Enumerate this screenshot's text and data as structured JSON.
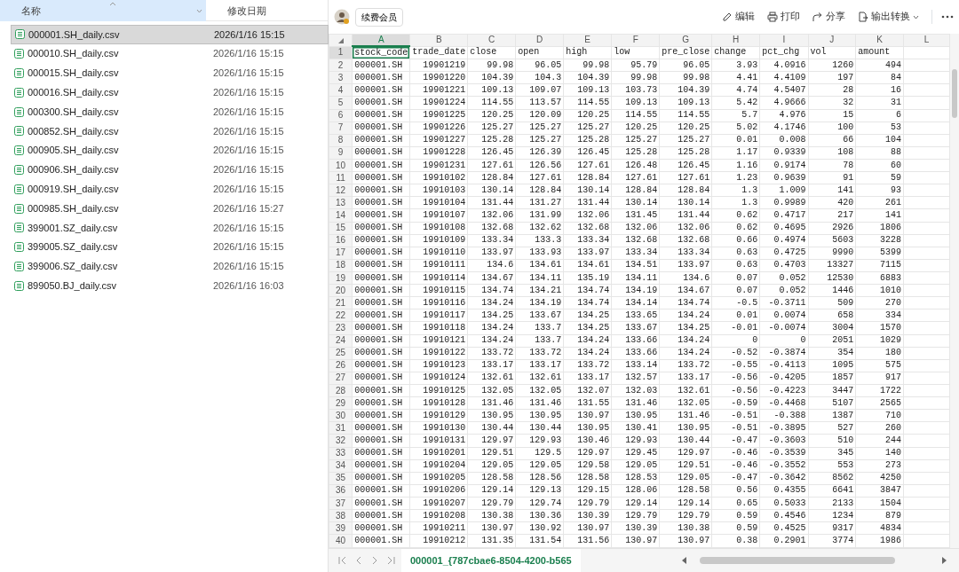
{
  "explorer": {
    "columns": [
      {
        "label": "名称",
        "hovered": true
      },
      {
        "label": "修改日期",
        "hovered": false
      }
    ],
    "files": [
      {
        "name": "000001.SH_daily.csv",
        "modified": "2026/1/16 15:15",
        "selected": true
      },
      {
        "name": "000010.SH_daily.csv",
        "modified": "2026/1/16 15:15",
        "selected": false
      },
      {
        "name": "000015.SH_daily.csv",
        "modified": "2026/1/16 15:15",
        "selected": false
      },
      {
        "name": "000016.SH_daily.csv",
        "modified": "2026/1/16 15:15",
        "selected": false
      },
      {
        "name": "000300.SH_daily.csv",
        "modified": "2026/1/16 15:15",
        "selected": false
      },
      {
        "name": "000852.SH_daily.csv",
        "modified": "2026/1/16 15:15",
        "selected": false
      },
      {
        "name": "000905.SH_daily.csv",
        "modified": "2026/1/16 15:15",
        "selected": false
      },
      {
        "name": "000906.SH_daily.csv",
        "modified": "2026/1/16 15:15",
        "selected": false
      },
      {
        "name": "000919.SH_daily.csv",
        "modified": "2026/1/16 15:15",
        "selected": false
      },
      {
        "name": "000985.SH_daily.csv",
        "modified": "2026/1/16 15:27",
        "selected": false
      },
      {
        "name": "399001.SZ_daily.csv",
        "modified": "2026/1/16 15:15",
        "selected": false
      },
      {
        "name": "399005.SZ_daily.csv",
        "modified": "2026/1/16 15:15",
        "selected": false
      },
      {
        "name": "399006.SZ_daily.csv",
        "modified": "2026/1/16 15:15",
        "selected": false
      },
      {
        "name": "899050.BJ_daily.csv",
        "modified": "2026/1/16 16:03",
        "selected": false
      }
    ]
  },
  "toolbar": {
    "member_button": "续费会员",
    "actions": [
      {
        "kind": "edit",
        "label": "编辑"
      },
      {
        "kind": "print",
        "label": "打印"
      },
      {
        "kind": "share",
        "label": "分享"
      },
      {
        "kind": "export",
        "label": "输出转换"
      }
    ]
  },
  "sheet": {
    "columns": [
      {
        "letter": "A",
        "selected": true
      },
      {
        "letter": "B",
        "selected": false
      },
      {
        "letter": "C",
        "selected": false
      },
      {
        "letter": "D",
        "selected": false
      },
      {
        "letter": "E",
        "selected": false
      },
      {
        "letter": "F",
        "selected": false
      },
      {
        "letter": "G",
        "selected": false
      },
      {
        "letter": "H",
        "selected": false
      },
      {
        "letter": "I",
        "selected": false
      },
      {
        "letter": "J",
        "selected": false
      },
      {
        "letter": "K",
        "selected": false
      },
      {
        "letter": "L",
        "selected": false
      }
    ],
    "rows": [
      {
        "number": "1",
        "kind": "header",
        "selected": true,
        "cells": [
          "stock_code",
          "trade_date",
          "close",
          "open",
          "high",
          "low",
          "pre_close",
          "change",
          "pct_chg",
          "vol",
          "amount"
        ]
      },
      {
        "number": "2",
        "kind": "data",
        "selected": false,
        "cells": [
          "000001.SH",
          "19901219",
          "99.98",
          "96.05",
          "99.98",
          "95.79",
          "96.05",
          "3.93",
          "4.0916",
          "1260",
          "494"
        ]
      },
      {
        "number": "3",
        "kind": "data",
        "selected": false,
        "cells": [
          "000001.SH",
          "19901220",
          "104.39",
          "104.3",
          "104.39",
          "99.98",
          "99.98",
          "4.41",
          "4.4109",
          "197",
          "84"
        ]
      },
      {
        "number": "4",
        "kind": "data",
        "selected": false,
        "cells": [
          "000001.SH",
          "19901221",
          "109.13",
          "109.07",
          "109.13",
          "103.73",
          "104.39",
          "4.74",
          "4.5407",
          "28",
          "16"
        ]
      },
      {
        "number": "5",
        "kind": "data",
        "selected": false,
        "cells": [
          "000001.SH",
          "19901224",
          "114.55",
          "113.57",
          "114.55",
          "109.13",
          "109.13",
          "5.42",
          "4.9666",
          "32",
          "31"
        ]
      },
      {
        "number": "6",
        "kind": "data",
        "selected": false,
        "cells": [
          "000001.SH",
          "19901225",
          "120.25",
          "120.09",
          "120.25",
          "114.55",
          "114.55",
          "5.7",
          "4.976",
          "15",
          "6"
        ]
      },
      {
        "number": "7",
        "kind": "data",
        "selected": false,
        "cells": [
          "000001.SH",
          "19901226",
          "125.27",
          "125.27",
          "125.27",
          "120.25",
          "120.25",
          "5.02",
          "4.1746",
          "100",
          "53"
        ]
      },
      {
        "number": "8",
        "kind": "data",
        "selected": false,
        "cells": [
          "000001.SH",
          "19901227",
          "125.28",
          "125.27",
          "125.28",
          "125.27",
          "125.27",
          "0.01",
          "0.008",
          "66",
          "104"
        ]
      },
      {
        "number": "9",
        "kind": "data",
        "selected": false,
        "cells": [
          "000001.SH",
          "19901228",
          "126.45",
          "126.39",
          "126.45",
          "125.28",
          "125.28",
          "1.17",
          "0.9339",
          "108",
          "88"
        ]
      },
      {
        "number": "10",
        "kind": "data",
        "selected": false,
        "cells": [
          "000001.SH",
          "19901231",
          "127.61",
          "126.56",
          "127.61",
          "126.48",
          "126.45",
          "1.16",
          "0.9174",
          "78",
          "60"
        ]
      },
      {
        "number": "11",
        "kind": "data",
        "selected": false,
        "cells": [
          "000001.SH",
          "19910102",
          "128.84",
          "127.61",
          "128.84",
          "127.61",
          "127.61",
          "1.23",
          "0.9639",
          "91",
          "59"
        ]
      },
      {
        "number": "12",
        "kind": "data",
        "selected": false,
        "cells": [
          "000001.SH",
          "19910103",
          "130.14",
          "128.84",
          "130.14",
          "128.84",
          "128.84",
          "1.3",
          "1.009",
          "141",
          "93"
        ]
      },
      {
        "number": "13",
        "kind": "data",
        "selected": false,
        "cells": [
          "000001.SH",
          "19910104",
          "131.44",
          "131.27",
          "131.44",
          "130.14",
          "130.14",
          "1.3",
          "0.9989",
          "420",
          "261"
        ]
      },
      {
        "number": "14",
        "kind": "data",
        "selected": false,
        "cells": [
          "000001.SH",
          "19910107",
          "132.06",
          "131.99",
          "132.06",
          "131.45",
          "131.44",
          "0.62",
          "0.4717",
          "217",
          "141"
        ]
      },
      {
        "number": "15",
        "kind": "data",
        "selected": false,
        "cells": [
          "000001.SH",
          "19910108",
          "132.68",
          "132.62",
          "132.68",
          "132.06",
          "132.06",
          "0.62",
          "0.4695",
          "2926",
          "1806"
        ]
      },
      {
        "number": "16",
        "kind": "data",
        "selected": false,
        "cells": [
          "000001.SH",
          "19910109",
          "133.34",
          "133.3",
          "133.34",
          "132.68",
          "132.68",
          "0.66",
          "0.4974",
          "5603",
          "3228"
        ]
      },
      {
        "number": "17",
        "kind": "data",
        "selected": false,
        "cells": [
          "000001.SH",
          "19910110",
          "133.97",
          "133.93",
          "133.97",
          "133.34",
          "133.34",
          "0.63",
          "0.4725",
          "9990",
          "5399"
        ]
      },
      {
        "number": "18",
        "kind": "data",
        "selected": false,
        "cells": [
          "000001.SH",
          "19910111",
          "134.6",
          "134.61",
          "134.61",
          "134.51",
          "133.97",
          "0.63",
          "0.4703",
          "13327",
          "7115"
        ]
      },
      {
        "number": "19",
        "kind": "data",
        "selected": false,
        "cells": [
          "000001.SH",
          "19910114",
          "134.67",
          "134.11",
          "135.19",
          "134.11",
          "134.6",
          "0.07",
          "0.052",
          "12530",
          "6883"
        ]
      },
      {
        "number": "20",
        "kind": "data",
        "selected": false,
        "cells": [
          "000001.SH",
          "19910115",
          "134.74",
          "134.21",
          "134.74",
          "134.19",
          "134.67",
          "0.07",
          "0.052",
          "1446",
          "1010"
        ]
      },
      {
        "number": "21",
        "kind": "data",
        "selected": false,
        "cells": [
          "000001.SH",
          "19910116",
          "134.24",
          "134.19",
          "134.74",
          "134.14",
          "134.74",
          "-0.5",
          "-0.3711",
          "509",
          "270"
        ]
      },
      {
        "number": "22",
        "kind": "data",
        "selected": false,
        "cells": [
          "000001.SH",
          "19910117",
          "134.25",
          "133.67",
          "134.25",
          "133.65",
          "134.24",
          "0.01",
          "0.0074",
          "658",
          "334"
        ]
      },
      {
        "number": "23",
        "kind": "data",
        "selected": false,
        "cells": [
          "000001.SH",
          "19910118",
          "134.24",
          "133.7",
          "134.25",
          "133.67",
          "134.25",
          "-0.01",
          "-0.0074",
          "3004",
          "1570"
        ]
      },
      {
        "number": "24",
        "kind": "data",
        "selected": false,
        "cells": [
          "000001.SH",
          "19910121",
          "134.24",
          "133.7",
          "134.24",
          "133.66",
          "134.24",
          "0",
          "0",
          "2051",
          "1029"
        ]
      },
      {
        "number": "25",
        "kind": "data",
        "selected": false,
        "cells": [
          "000001.SH",
          "19910122",
          "133.72",
          "133.72",
          "134.24",
          "133.66",
          "134.24",
          "-0.52",
          "-0.3874",
          "354",
          "180"
        ]
      },
      {
        "number": "26",
        "kind": "data",
        "selected": false,
        "cells": [
          "000001.SH",
          "19910123",
          "133.17",
          "133.17",
          "133.72",
          "133.14",
          "133.72",
          "-0.55",
          "-0.4113",
          "1095",
          "575"
        ]
      },
      {
        "number": "27",
        "kind": "data",
        "selected": false,
        "cells": [
          "000001.SH",
          "19910124",
          "132.61",
          "132.61",
          "133.17",
          "132.57",
          "133.17",
          "-0.56",
          "-0.4205",
          "1857",
          "917"
        ]
      },
      {
        "number": "28",
        "kind": "data",
        "selected": false,
        "cells": [
          "000001.SH",
          "19910125",
          "132.05",
          "132.05",
          "132.07",
          "132.03",
          "132.61",
          "-0.56",
          "-0.4223",
          "3447",
          "1722"
        ]
      },
      {
        "number": "29",
        "kind": "data",
        "selected": false,
        "cells": [
          "000001.SH",
          "19910128",
          "131.46",
          "131.46",
          "131.55",
          "131.46",
          "132.05",
          "-0.59",
          "-0.4468",
          "5107",
          "2565"
        ]
      },
      {
        "number": "30",
        "kind": "data",
        "selected": false,
        "cells": [
          "000001.SH",
          "19910129",
          "130.95",
          "130.95",
          "130.97",
          "130.95",
          "131.46",
          "-0.51",
          "-0.388",
          "1387",
          "710"
        ]
      },
      {
        "number": "31",
        "kind": "data",
        "selected": false,
        "cells": [
          "000001.SH",
          "19910130",
          "130.44",
          "130.44",
          "130.95",
          "130.41",
          "130.95",
          "-0.51",
          "-0.3895",
          "527",
          "260"
        ]
      },
      {
        "number": "32",
        "kind": "data",
        "selected": false,
        "cells": [
          "000001.SH",
          "19910131",
          "129.97",
          "129.93",
          "130.46",
          "129.93",
          "130.44",
          "-0.47",
          "-0.3603",
          "510",
          "244"
        ]
      },
      {
        "number": "33",
        "kind": "data",
        "selected": false,
        "cells": [
          "000001.SH",
          "19910201",
          "129.51",
          "129.5",
          "129.97",
          "129.45",
          "129.97",
          "-0.46",
          "-0.3539",
          "345",
          "140"
        ]
      },
      {
        "number": "34",
        "kind": "data",
        "selected": false,
        "cells": [
          "000001.SH",
          "19910204",
          "129.05",
          "129.05",
          "129.58",
          "129.05",
          "129.51",
          "-0.46",
          "-0.3552",
          "553",
          "273"
        ]
      },
      {
        "number": "35",
        "kind": "data",
        "selected": false,
        "cells": [
          "000001.SH",
          "19910205",
          "128.58",
          "128.56",
          "128.58",
          "128.53",
          "129.05",
          "-0.47",
          "-0.3642",
          "8562",
          "4250"
        ]
      },
      {
        "number": "36",
        "kind": "data",
        "selected": false,
        "cells": [
          "000001.SH",
          "19910206",
          "129.14",
          "129.13",
          "129.15",
          "128.06",
          "128.58",
          "0.56",
          "0.4355",
          "6641",
          "3847"
        ]
      },
      {
        "number": "37",
        "kind": "data",
        "selected": false,
        "cells": [
          "000001.SH",
          "19910207",
          "129.79",
          "129.74",
          "129.79",
          "129.14",
          "129.14",
          "0.65",
          "0.5033",
          "2133",
          "1504"
        ]
      },
      {
        "number": "38",
        "kind": "data",
        "selected": false,
        "cells": [
          "000001.SH",
          "19910208",
          "130.38",
          "130.36",
          "130.39",
          "129.79",
          "129.79",
          "0.59",
          "0.4546",
          "1234",
          "879"
        ]
      },
      {
        "number": "39",
        "kind": "data",
        "selected": false,
        "cells": [
          "000001.SH",
          "19910211",
          "130.97",
          "130.92",
          "130.97",
          "130.39",
          "130.38",
          "0.59",
          "0.4525",
          "9317",
          "4834"
        ]
      },
      {
        "number": "40",
        "kind": "data",
        "selected": false,
        "cells": [
          "000001.SH",
          "19910212",
          "131.35",
          "131.54",
          "131.56",
          "130.97",
          "130.97",
          "0.38",
          "0.2901",
          "3774",
          "1986"
        ]
      }
    ]
  },
  "sheet_tabs": [
    {
      "label": "000001_{787cbae6-8504-4200-b565",
      "selected": true
    }
  ]
}
